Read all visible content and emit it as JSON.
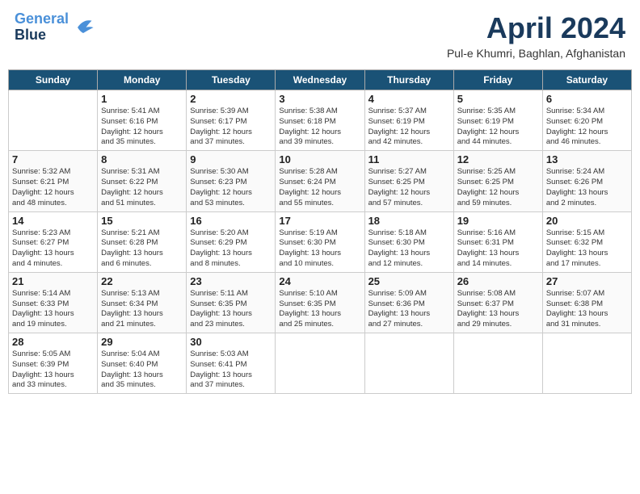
{
  "header": {
    "logo_line1": "General",
    "logo_line2": "Blue",
    "month": "April 2024",
    "location": "Pul-e Khumri, Baghlan, Afghanistan"
  },
  "weekdays": [
    "Sunday",
    "Monday",
    "Tuesday",
    "Wednesday",
    "Thursday",
    "Friday",
    "Saturday"
  ],
  "weeks": [
    [
      {
        "day": "",
        "info": ""
      },
      {
        "day": "1",
        "info": "Sunrise: 5:41 AM\nSunset: 6:16 PM\nDaylight: 12 hours\nand 35 minutes."
      },
      {
        "day": "2",
        "info": "Sunrise: 5:39 AM\nSunset: 6:17 PM\nDaylight: 12 hours\nand 37 minutes."
      },
      {
        "day": "3",
        "info": "Sunrise: 5:38 AM\nSunset: 6:18 PM\nDaylight: 12 hours\nand 39 minutes."
      },
      {
        "day": "4",
        "info": "Sunrise: 5:37 AM\nSunset: 6:19 PM\nDaylight: 12 hours\nand 42 minutes."
      },
      {
        "day": "5",
        "info": "Sunrise: 5:35 AM\nSunset: 6:19 PM\nDaylight: 12 hours\nand 44 minutes."
      },
      {
        "day": "6",
        "info": "Sunrise: 5:34 AM\nSunset: 6:20 PM\nDaylight: 12 hours\nand 46 minutes."
      }
    ],
    [
      {
        "day": "7",
        "info": "Sunrise: 5:32 AM\nSunset: 6:21 PM\nDaylight: 12 hours\nand 48 minutes."
      },
      {
        "day": "8",
        "info": "Sunrise: 5:31 AM\nSunset: 6:22 PM\nDaylight: 12 hours\nand 51 minutes."
      },
      {
        "day": "9",
        "info": "Sunrise: 5:30 AM\nSunset: 6:23 PM\nDaylight: 12 hours\nand 53 minutes."
      },
      {
        "day": "10",
        "info": "Sunrise: 5:28 AM\nSunset: 6:24 PM\nDaylight: 12 hours\nand 55 minutes."
      },
      {
        "day": "11",
        "info": "Sunrise: 5:27 AM\nSunset: 6:25 PM\nDaylight: 12 hours\nand 57 minutes."
      },
      {
        "day": "12",
        "info": "Sunrise: 5:25 AM\nSunset: 6:25 PM\nDaylight: 12 hours\nand 59 minutes."
      },
      {
        "day": "13",
        "info": "Sunrise: 5:24 AM\nSunset: 6:26 PM\nDaylight: 13 hours\nand 2 minutes."
      }
    ],
    [
      {
        "day": "14",
        "info": "Sunrise: 5:23 AM\nSunset: 6:27 PM\nDaylight: 13 hours\nand 4 minutes."
      },
      {
        "day": "15",
        "info": "Sunrise: 5:21 AM\nSunset: 6:28 PM\nDaylight: 13 hours\nand 6 minutes."
      },
      {
        "day": "16",
        "info": "Sunrise: 5:20 AM\nSunset: 6:29 PM\nDaylight: 13 hours\nand 8 minutes."
      },
      {
        "day": "17",
        "info": "Sunrise: 5:19 AM\nSunset: 6:30 PM\nDaylight: 13 hours\nand 10 minutes."
      },
      {
        "day": "18",
        "info": "Sunrise: 5:18 AM\nSunset: 6:30 PM\nDaylight: 13 hours\nand 12 minutes."
      },
      {
        "day": "19",
        "info": "Sunrise: 5:16 AM\nSunset: 6:31 PM\nDaylight: 13 hours\nand 14 minutes."
      },
      {
        "day": "20",
        "info": "Sunrise: 5:15 AM\nSunset: 6:32 PM\nDaylight: 13 hours\nand 17 minutes."
      }
    ],
    [
      {
        "day": "21",
        "info": "Sunrise: 5:14 AM\nSunset: 6:33 PM\nDaylight: 13 hours\nand 19 minutes."
      },
      {
        "day": "22",
        "info": "Sunrise: 5:13 AM\nSunset: 6:34 PM\nDaylight: 13 hours\nand 21 minutes."
      },
      {
        "day": "23",
        "info": "Sunrise: 5:11 AM\nSunset: 6:35 PM\nDaylight: 13 hours\nand 23 minutes."
      },
      {
        "day": "24",
        "info": "Sunrise: 5:10 AM\nSunset: 6:35 PM\nDaylight: 13 hours\nand 25 minutes."
      },
      {
        "day": "25",
        "info": "Sunrise: 5:09 AM\nSunset: 6:36 PM\nDaylight: 13 hours\nand 27 minutes."
      },
      {
        "day": "26",
        "info": "Sunrise: 5:08 AM\nSunset: 6:37 PM\nDaylight: 13 hours\nand 29 minutes."
      },
      {
        "day": "27",
        "info": "Sunrise: 5:07 AM\nSunset: 6:38 PM\nDaylight: 13 hours\nand 31 minutes."
      }
    ],
    [
      {
        "day": "28",
        "info": "Sunrise: 5:05 AM\nSunset: 6:39 PM\nDaylight: 13 hours\nand 33 minutes."
      },
      {
        "day": "29",
        "info": "Sunrise: 5:04 AM\nSunset: 6:40 PM\nDaylight: 13 hours\nand 35 minutes."
      },
      {
        "day": "30",
        "info": "Sunrise: 5:03 AM\nSunset: 6:41 PM\nDaylight: 13 hours\nand 37 minutes."
      },
      {
        "day": "",
        "info": ""
      },
      {
        "day": "",
        "info": ""
      },
      {
        "day": "",
        "info": ""
      },
      {
        "day": "",
        "info": ""
      }
    ]
  ]
}
